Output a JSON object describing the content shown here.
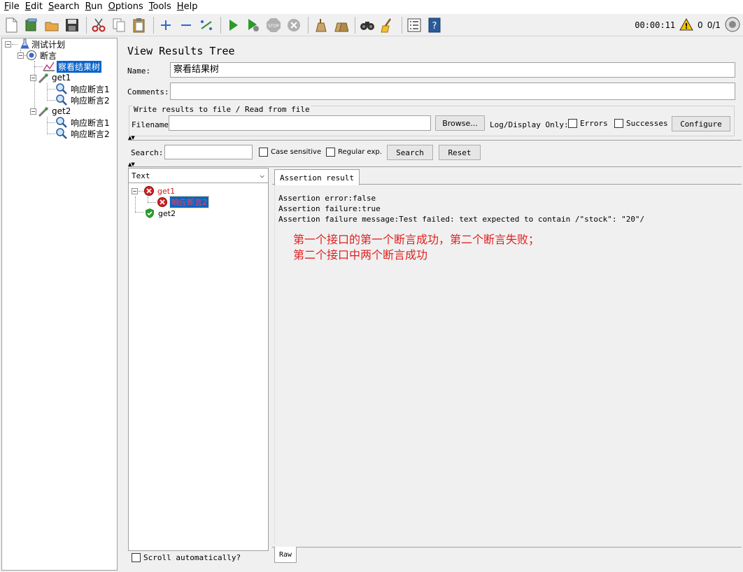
{
  "menu": [
    {
      "label": "File",
      "mnemonic": "F",
      "rest": "ile"
    },
    {
      "label": "Edit",
      "mnemonic": "E",
      "rest": "dit"
    },
    {
      "label": "Search",
      "mnemonic": "S",
      "rest": "earch"
    },
    {
      "label": "Run",
      "mnemonic": "R",
      "rest": "un"
    },
    {
      "label": "Options",
      "mnemonic": "O",
      "rest": "ptions"
    },
    {
      "label": "Tools",
      "mnemonic": "T",
      "rest": "ools"
    },
    {
      "label": "Help",
      "mnemonic": "H",
      "rest": "elp"
    }
  ],
  "toolbar": {
    "icons": [
      "new-icon",
      "templates-icon",
      "open-icon",
      "save-icon",
      "cut-icon",
      "copy-icon",
      "paste-icon",
      "expand-icon",
      "collapse-icon",
      "toggle-icon",
      "start-icon",
      "start-no-pause-icon",
      "stop-icon",
      "shutdown-icon",
      "clear-icon",
      "clear-all-icon",
      "search-icon",
      "reset-search-icon",
      "function-helper-icon",
      "help-icon"
    ],
    "timer": "00:00:11",
    "warning_count": "0",
    "threads": "0/1"
  },
  "tree": {
    "root": "测试计划",
    "thread_group": "断言",
    "listener": "察看结果树",
    "samplers": [
      {
        "name": "get1",
        "assertions": [
          "响应断言1",
          "响应断言2"
        ]
      },
      {
        "name": "get2",
        "assertions": [
          "响应断言1",
          "响应断言2"
        ]
      }
    ]
  },
  "panel": {
    "title": "View Results Tree",
    "name_label": "Name:",
    "name_value": "察看结果树",
    "comments_label": "Comments:",
    "comments_value": "",
    "file_legend": "Write results to file / Read from file",
    "filename_label": "Filename",
    "filename_value": "",
    "browse_label": "Browse...",
    "log_display_label": "Log/Display Only:",
    "errors_label": "Errors",
    "successes_label": "Successes",
    "configure_label": "Configure"
  },
  "search": {
    "label": "Search:",
    "value": "",
    "case_sensitive_label": "Case sensitive",
    "regex_label": "Regular exp.",
    "search_button": "Search",
    "reset_button": "Reset"
  },
  "results": {
    "renderer": "Text",
    "items": [
      {
        "name": "get1",
        "status": "fail",
        "children": [
          {
            "name": "响应断言2",
            "status": "fail"
          }
        ]
      },
      {
        "name": "get2",
        "status": "pass",
        "children": []
      }
    ],
    "scroll_auto_label": "Scroll automatically?",
    "tab_label": "Assertion result",
    "raw_tab_label": "Raw",
    "lines": [
      "Assertion error:false",
      "Assertion failure:true",
      "Assertion failure message:Test failed: text expected to contain /\"stock\": \"20\"/"
    ],
    "annotation": [
      "第一个接口的第一个断言成功，第二个断言失败；",
      "第二个接口中两个断言成功"
    ]
  },
  "colors": {
    "selection": "#0a64c8",
    "fail": "#d02020",
    "pass": "#2a9a2a",
    "annotation": "#e02020"
  }
}
